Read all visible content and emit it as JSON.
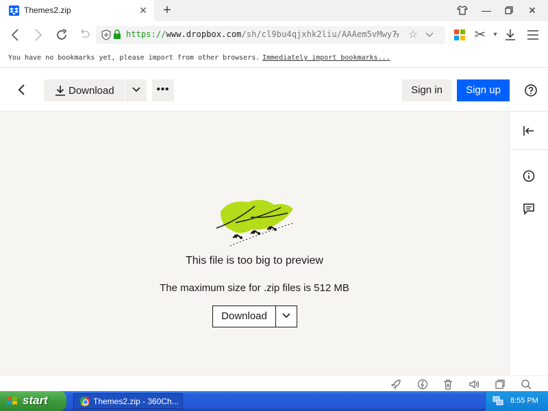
{
  "browser": {
    "tab": {
      "title": "Themes2.zip",
      "favicon": "dropbox-icon"
    },
    "url": {
      "scheme": "https://",
      "host": "www.dropbox.com",
      "path": "/sh/cl9bu4qjxhk2liu/AAAem5vMwy7"
    },
    "bookmarks_bar": {
      "message": "You have no bookmarks yet, please import from other browsers.",
      "link": "Immediately import bookmarks..."
    }
  },
  "header": {
    "download_label": "Download",
    "more_label": "•••",
    "signin_label": "Sign in",
    "signup_label": "Sign up",
    "accent": "#0061fe"
  },
  "preview": {
    "title": "This file is too big to preview",
    "subtitle": "The maximum size for .zip files is 512 MB",
    "download_label": "Download"
  },
  "taskbar": {
    "start_label": "start",
    "task_label": "Themes2.zip - 360Ch...",
    "clock": "8:55 PM"
  }
}
